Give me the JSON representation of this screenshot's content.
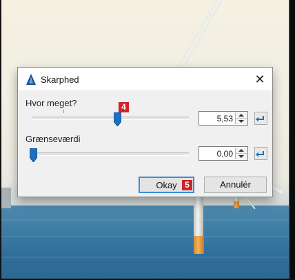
{
  "dialog": {
    "title": "Skarphed",
    "close_label": "✕",
    "amount": {
      "label": "Hvor meget?",
      "value": "5,53",
      "slider_fraction": 0.53
    },
    "threshold": {
      "label": "Grænseværdi",
      "value": "0,00",
      "slider_fraction": 0.0
    },
    "ok_label": "Okay",
    "cancel_label": "Annulér"
  },
  "annotations": {
    "slider_marker": "4",
    "ok_marker": "5"
  },
  "colors": {
    "accent": "#1f6fbf",
    "badge": "#d2232a",
    "ok_border": "#3b8ede"
  }
}
